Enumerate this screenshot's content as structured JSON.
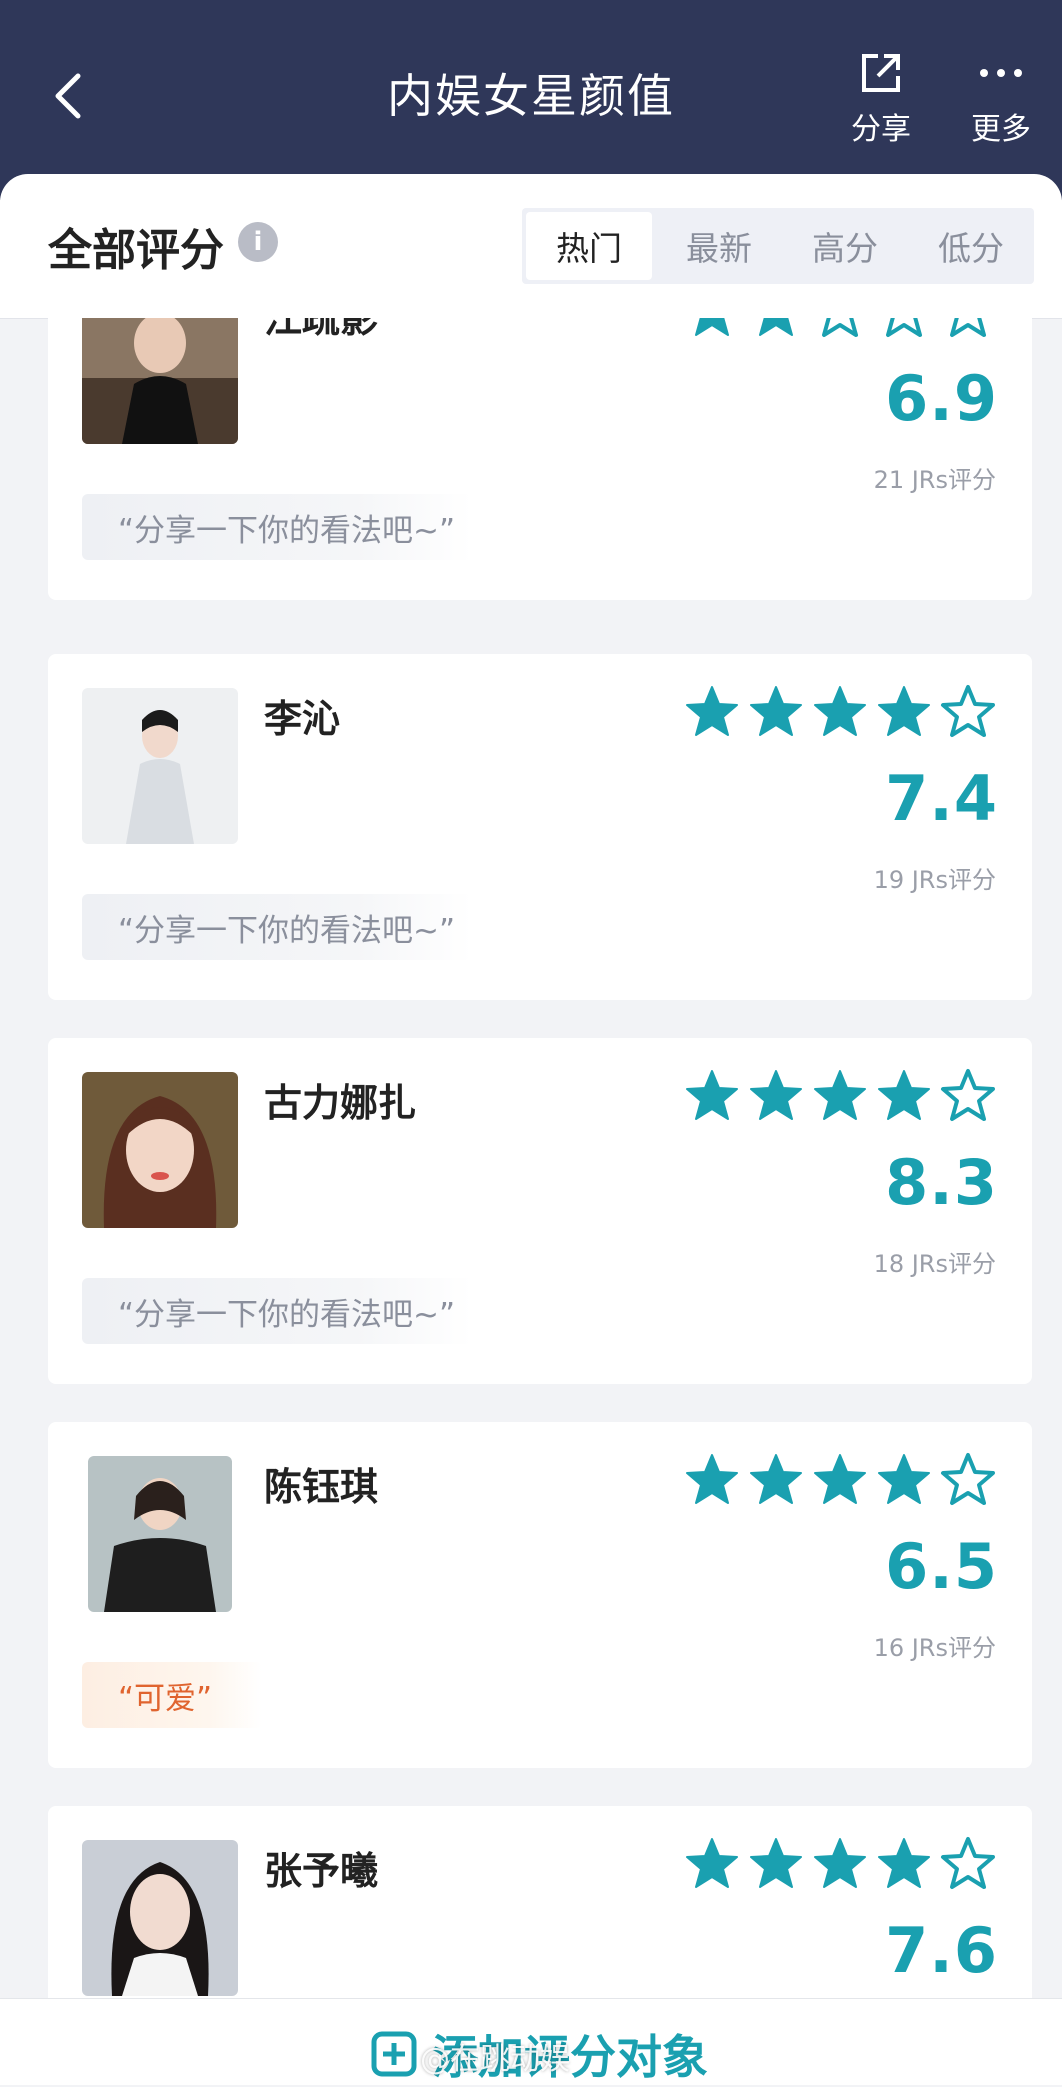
{
  "header": {
    "title": "内娱女星颜值",
    "share_label": "分享",
    "more_label": "更多"
  },
  "section": {
    "title": "全部评分",
    "tabs": [
      {
        "label": "热门",
        "active": true
      },
      {
        "label": "最新",
        "active": false
      },
      {
        "label": "高分",
        "active": false
      },
      {
        "label": "低分",
        "active": false
      }
    ]
  },
  "items": [
    {
      "name": "江疏影",
      "score": "6.9",
      "stars": 2,
      "count": "21 JRs评分",
      "comment": "“分享一下你的看法吧~”",
      "comment_type": "placeholder"
    },
    {
      "name": "李沁",
      "score": "7.4",
      "stars": 4,
      "count": "19 JRs评分",
      "comment": "“分享一下你的看法吧~”",
      "comment_type": "placeholder"
    },
    {
      "name": "古力娜扎",
      "score": "8.3",
      "stars": 4,
      "count": "18 JRs评分",
      "comment": "“分享一下你的看法吧~”",
      "comment_type": "placeholder"
    },
    {
      "name": "陈钰琪",
      "score": "6.5",
      "stars": 4,
      "count": "16 JRs评分",
      "comment": "“可爱”",
      "comment_type": "tag"
    },
    {
      "name": "张予曦",
      "score": "7.6",
      "stars": 4,
      "count": "",
      "comment": "",
      "comment_type": "none"
    }
  ],
  "footer": {
    "add_label": "添加评分对象",
    "watermark": "@在跳动娱"
  },
  "colors": {
    "header_bg": "#2f3759",
    "accent": "#1aa0b0",
    "tag": "#e0642f"
  }
}
